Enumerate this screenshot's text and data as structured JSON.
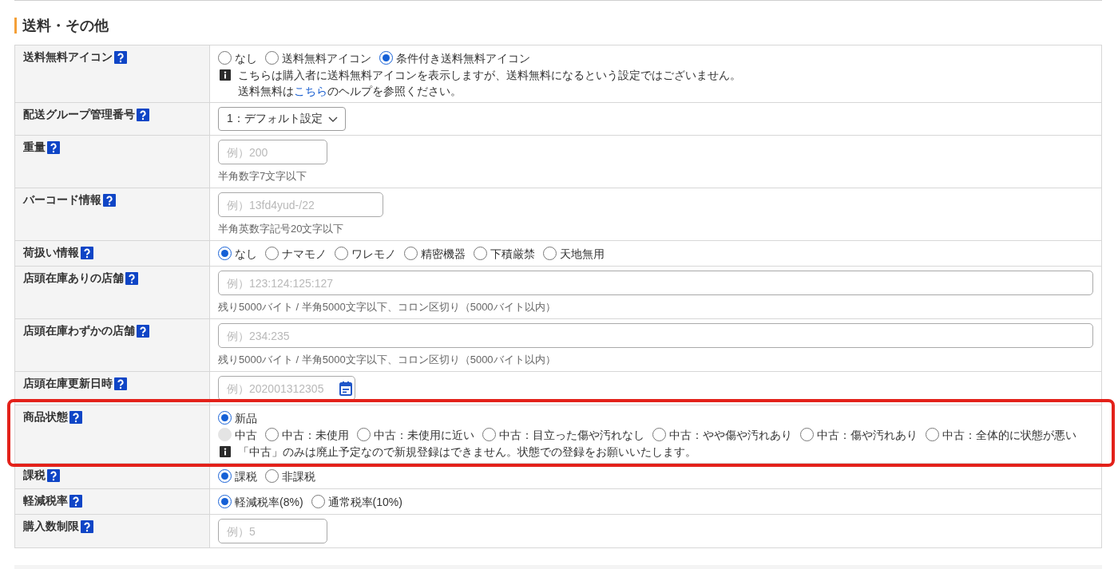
{
  "section": {
    "title": "送料・その他"
  },
  "rows": [
    {
      "label": "送料無料アイコン",
      "kind": "radio",
      "highlighted": false,
      "option_lines": [
        [
          {
            "label": "なし",
            "selected": false
          },
          {
            "label": "送料無料アイコン",
            "selected": false
          },
          {
            "label": "条件付き送料無料アイコン",
            "selected": true
          }
        ]
      ],
      "note": [
        {
          "text": "こちらは購入者に送料無料アイコンを表示しますが、送料無料になるという設定ではございません。"
        },
        {
          "text": "送料無料は",
          "link": "こちら",
          "text_after": "のヘルプを参照ください。"
        }
      ]
    },
    {
      "label": "配送グループ管理番号",
      "kind": "select",
      "highlighted": false,
      "value": "1：デフォルト設定"
    },
    {
      "label": "重量",
      "kind": "input",
      "highlighted": false,
      "placeholder": "例）200",
      "hint": "半角数字7文字以下"
    },
    {
      "label": "バーコード情報",
      "kind": "input",
      "highlighted": false,
      "placeholder": "例）13fd4yud-/22",
      "hint": "半角英数字記号20文字以下"
    },
    {
      "label": "荷扱い情報",
      "kind": "radio",
      "highlighted": false,
      "option_lines": [
        [
          {
            "label": "なし",
            "selected": true
          },
          {
            "label": "ナマモノ",
            "selected": false
          },
          {
            "label": "ワレモノ",
            "selected": false
          },
          {
            "label": "精密機器",
            "selected": false
          },
          {
            "label": "下積厳禁",
            "selected": false
          },
          {
            "label": "天地無用",
            "selected": false
          }
        ]
      ]
    },
    {
      "label": "店頭在庫ありの店舗",
      "kind": "input",
      "highlighted": false,
      "placeholder": "例）123:124:125:127",
      "hint": "残り5000バイト / 半角5000文字以下、コロン区切り（5000バイト以内）"
    },
    {
      "label": "店頭在庫わずかの店舗",
      "kind": "input",
      "highlighted": false,
      "placeholder": "例）234:235",
      "hint": "残り5000バイト / 半角5000文字以下、コロン区切り（5000バイト以内）"
    },
    {
      "label": "店頭在庫更新日時",
      "kind": "date",
      "highlighted": false,
      "placeholder": "例）202001312305"
    },
    {
      "label": "商品状態",
      "kind": "radio",
      "highlighted": true,
      "option_lines": [
        [
          {
            "label": "新品",
            "selected": true,
            "disabled": false
          }
        ],
        [
          {
            "label": "中古",
            "selected": false,
            "disabled": true
          },
          {
            "label": "中古：未使用",
            "selected": false,
            "disabled": false
          },
          {
            "label": "中古：未使用に近い",
            "selected": false,
            "disabled": false
          },
          {
            "label": "中古：目立った傷や汚れなし",
            "selected": false,
            "disabled": false
          },
          {
            "label": "中古：やや傷や汚れあり",
            "selected": false,
            "disabled": false
          },
          {
            "label": "中古：傷や汚れあり",
            "selected": false,
            "disabled": false
          },
          {
            "label": "中古：全体的に状態が悪い",
            "selected": false,
            "disabled": false
          }
        ]
      ],
      "note": [
        {
          "text": "「中古」のみは廃止予定なので新規登録はできません。状態での登録をお願いいたします。"
        }
      ]
    },
    {
      "label": "課税",
      "kind": "radio",
      "highlighted": false,
      "option_lines": [
        [
          {
            "label": "課税",
            "selected": true
          },
          {
            "label": "非課税",
            "selected": false
          }
        ]
      ]
    },
    {
      "label": "軽減税率",
      "kind": "radio",
      "highlighted": false,
      "option_lines": [
        [
          {
            "label": "軽減税率(8%)",
            "selected": true
          },
          {
            "label": "通常税率(10%)",
            "selected": false
          }
        ]
      ]
    },
    {
      "label": "購入数制限",
      "kind": "input",
      "highlighted": false,
      "placeholder": "例）5"
    }
  ]
}
